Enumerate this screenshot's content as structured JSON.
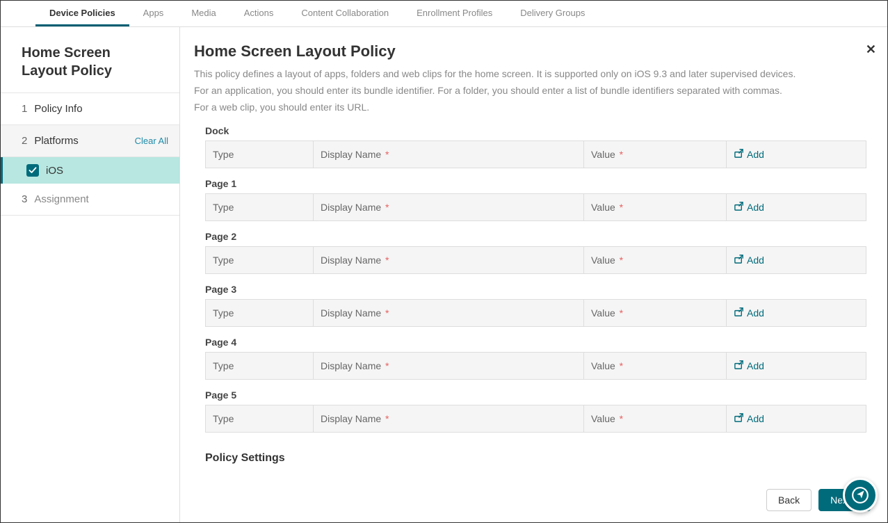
{
  "topnav": [
    "Device Policies",
    "Apps",
    "Media",
    "Actions",
    "Content Collaboration",
    "Enrollment Profiles",
    "Delivery Groups"
  ],
  "topnav_active": 0,
  "sidebar": {
    "title": "Home Screen Layout Policy",
    "steps": {
      "policy_info": {
        "num": "1",
        "label": "Policy Info"
      },
      "platforms": {
        "num": "2",
        "label": "Platforms",
        "clear": "Clear All"
      },
      "ios": "iOS",
      "assignment": {
        "num": "3",
        "label": "Assignment"
      }
    }
  },
  "main": {
    "title": "Home Screen Layout Policy",
    "desc_line1": "This policy defines a layout of apps, folders and web clips for the home screen. It is supported only on iOS 9.3 and later supervised devices.",
    "desc_line2": "For an application, you should enter its bundle identifier. For a folder, you should enter a list of bundle identifiers separated with commas.",
    "desc_line3": "For a web clip, you should enter its URL.",
    "columns": {
      "type": "Type",
      "display": "Display Name",
      "value": "Value",
      "add": "Add"
    },
    "sections": [
      "Dock",
      "Page 1",
      "Page 2",
      "Page 3",
      "Page 4",
      "Page 5"
    ],
    "policy_settings": "Policy Settings",
    "buttons": {
      "back": "Back",
      "next": "Next >"
    }
  }
}
